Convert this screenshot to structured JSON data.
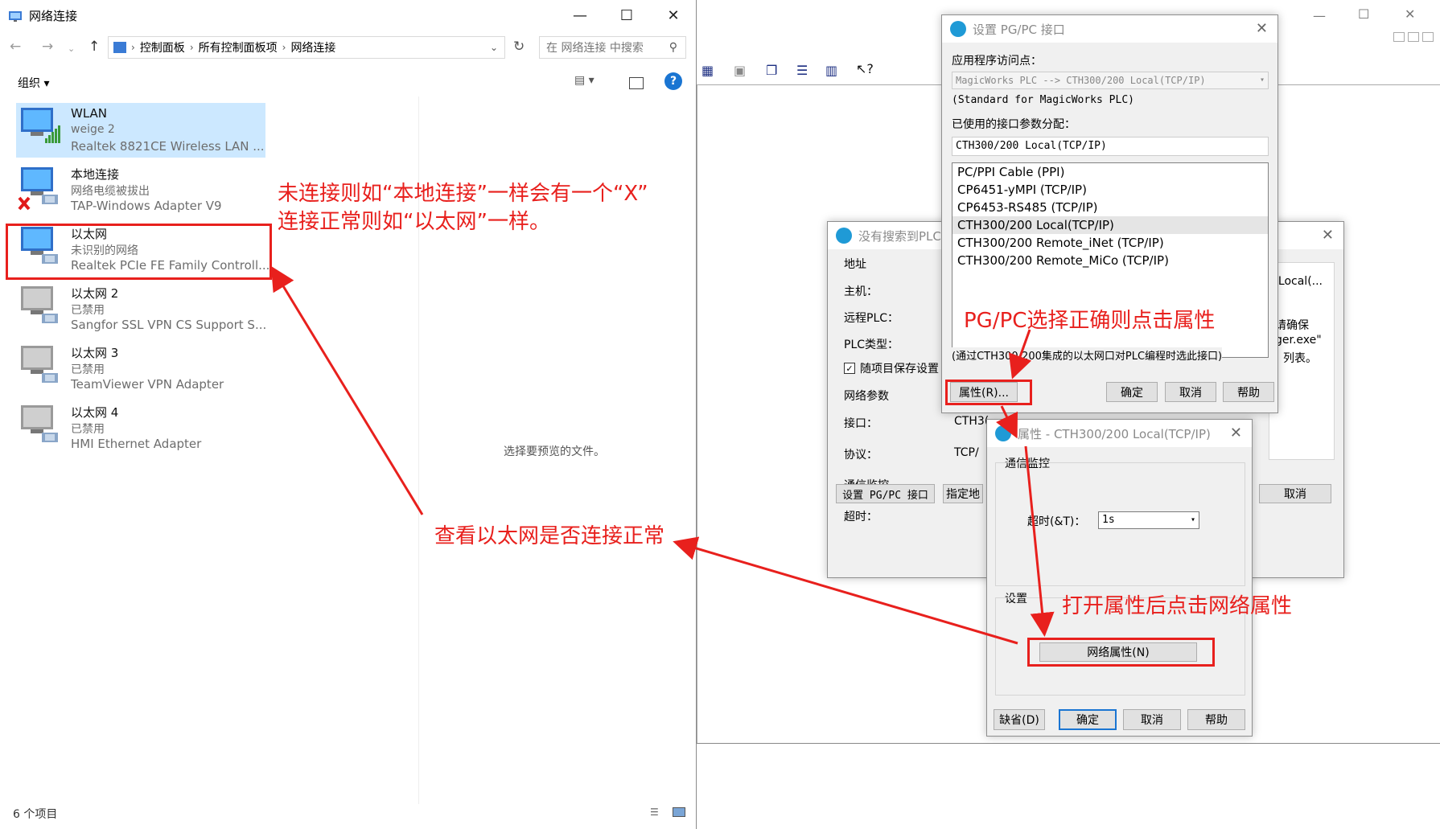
{
  "explorer": {
    "title": "网络连接",
    "breadcrumb": [
      "控制面板",
      "所有控制面板项",
      "网络连接"
    ],
    "search_placeholder": "在 网络连接 中搜索",
    "organize_label": "组织",
    "preview_text": "选择要预览的文件。",
    "status_text": "6 个项目",
    "items": [
      {
        "name": "WLAN",
        "status": "weige 2",
        "adapter": "Realtek 8821CE Wireless LAN ..."
      },
      {
        "name": "本地连接",
        "status": "网络电缆被拔出",
        "adapter": "TAP-Windows Adapter V9"
      },
      {
        "name": "以太网",
        "status": "未识别的网络",
        "adapter": "Realtek PCIe FE Family Controll..."
      },
      {
        "name": "以太网 2",
        "status": "已禁用",
        "adapter": "Sangfor SSL VPN CS Support S..."
      },
      {
        "name": "以太网 3",
        "status": "已禁用",
        "adapter": "TeamViewer VPN Adapter"
      },
      {
        "name": "以太网 4",
        "status": "已禁用",
        "adapter": "HMI Ethernet Adapter"
      }
    ]
  },
  "annotations": {
    "note_line1": "未连接则如“本地连接”一样会有一个“X”",
    "note_line2": "连接正常则如“以太网”一样。",
    "check_ethernet": "查看以太网是否连接正常",
    "pgpc_note": "PG/PC选择正确则点击属性",
    "open_props_note": "打开属性后点击网络属性"
  },
  "plc_dialog": {
    "title": "没有搜索到PLC",
    "address_label": "地址",
    "host_label": "主机：",
    "remote_plc_label": "远程PLC：",
    "plc_type_label": "PLC类型：",
    "save_with_project_label": "随项目保存设置",
    "save_with_project_checked": true,
    "net_params_label": "网络参数",
    "interface_label": "接口：",
    "interface_value": "CTH3(",
    "protocol_label": "协议：",
    "protocol_value": "TCP/",
    "comm_monitor_label": "通信监控",
    "timeout_label": "超时：",
    "right_text1": ") Local(...",
    "right_text2": "请确保",
    "right_text3": "ger.exe\"",
    "right_text4": "列表。",
    "set_pgpc_button": "设置 PG/PC 接口",
    "specify_button": "指定地",
    "cancel_button": "取消"
  },
  "pgpc_dialog": {
    "title": "设置 PG/PC 接口",
    "access_point_label": "应用程序访问点：",
    "access_point_value": "MagicWorks PLC --> CTH300/200 Local(TCP/IP)",
    "access_point_desc": "(Standard for MagicWorks PLC)",
    "assigned_label": "已使用的接口参数分配：",
    "assigned_value": "CTH300/200 Local(TCP/IP)",
    "list": [
      "PC/PPI Cable (PPI)",
      "CP6451-yMPI (TCP/IP)",
      "CP6453-RS485 (TCP/IP)",
      "CTH300/200 Local(TCP/IP)",
      "CTH300/200 Remote_iNet (TCP/IP)",
      "CTH300/200 Remote_MiCo (TCP/IP)"
    ],
    "selected_index": 3,
    "hint": "(通过CTH300/200集成的以太网口对PLC编程时选此接口)",
    "properties_button": "属性(R)...",
    "ok_button": "确定",
    "cancel_button": "取消",
    "help_button": "帮助"
  },
  "props_dialog": {
    "title": "属性 - CTH300/200 Local(TCP/IP)",
    "comm_monitor_label": "通信监控",
    "timeout_label": "超时(&T)：",
    "timeout_value": "1s",
    "settings_label": "设置",
    "net_props_button": "网络属性(N)",
    "default_button": "缺省(D)",
    "ok_button": "确定",
    "cancel_button": "取消",
    "help_button": "帮助"
  },
  "colors": {
    "annotation_red": "#e8201d",
    "selection_blue": "#cce8ff",
    "help_blue": "#1a75d2"
  }
}
